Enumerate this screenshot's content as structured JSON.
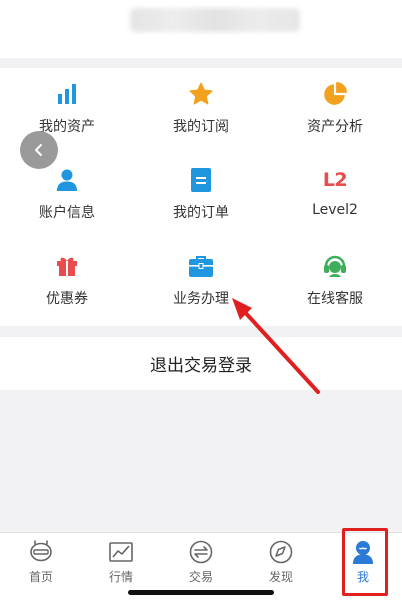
{
  "header": {
    "blurred": true
  },
  "grid": {
    "items": [
      {
        "label": "我的资产",
        "icon": "bar-chart-icon",
        "color": "#2196e0"
      },
      {
        "label": "我的订阅",
        "icon": "star-icon",
        "color": "#f2a11f"
      },
      {
        "label": "资产分析",
        "icon": "pie-chart-icon",
        "color": "#f2a11f"
      },
      {
        "label": "账户信息",
        "icon": "user-icon",
        "color": "#2196e0"
      },
      {
        "label": "我的订单",
        "icon": "order-icon",
        "color": "#2196e0"
      },
      {
        "label": "Level2",
        "icon": "l2-icon",
        "icon_text": "L2",
        "color": "#e84c4c"
      },
      {
        "label": "优惠券",
        "icon": "gift-icon",
        "color": "#e84c4c"
      },
      {
        "label": "业务办理",
        "icon": "briefcase-icon",
        "color": "#2196e0"
      },
      {
        "label": "在线客服",
        "icon": "customer-service-icon",
        "color": "#3fae5a"
      }
    ]
  },
  "logout": {
    "label": "退出交易登录"
  },
  "annotation": {
    "arrow_color": "#e02020",
    "box_color": "#e02020"
  },
  "tabbar": {
    "tabs": [
      {
        "label": "首页",
        "icon": "home-icon"
      },
      {
        "label": "行情",
        "icon": "market-chart-icon"
      },
      {
        "label": "交易",
        "icon": "trade-icon"
      },
      {
        "label": "发现",
        "icon": "compass-icon"
      },
      {
        "label": "我",
        "icon": "profile-icon",
        "active": true
      }
    ],
    "active_color": "#2a7ad6",
    "inactive_color": "#666666"
  }
}
